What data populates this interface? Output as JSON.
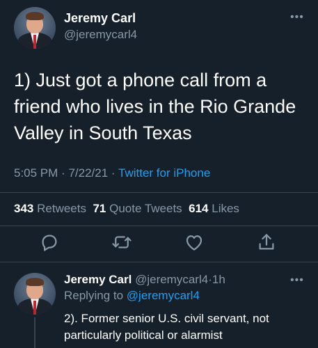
{
  "main_tweet": {
    "author_name": "Jeremy Carl",
    "author_handle": "@jeremycarl4",
    "more_icon": "more-horizontal-icon",
    "text": "1) Just got a phone call from a friend who lives in the Rio Grande Valley in South Texas",
    "time": "5:05 PM",
    "date": "7/22/21",
    "separator": "·",
    "source": "Twitter for iPhone",
    "stats": {
      "retweets_count": "343",
      "retweets_label": "Retweets",
      "quotes_count": "71",
      "quotes_label": "Quote Tweets",
      "likes_count": "614",
      "likes_label": "Likes"
    },
    "actions": [
      {
        "icon": "reply-icon"
      },
      {
        "icon": "retweet-icon"
      },
      {
        "icon": "like-icon"
      },
      {
        "icon": "share-icon"
      }
    ]
  },
  "reply_tweet": {
    "author_name": "Jeremy Carl",
    "author_handle": "@jeremycarl4",
    "separator": "·",
    "age": "1h",
    "replying_label": "Replying to",
    "replying_to": "@jeremycarl4",
    "more_icon": "more-horizontal-icon",
    "text": "2). Former senior U.S. civil servant, not particularly political or alarmist"
  },
  "colors": {
    "background": "#15202b",
    "text": "#ffffff",
    "secondary": "#8899a6",
    "accent": "#1da1f2",
    "divider": "#38444d"
  }
}
